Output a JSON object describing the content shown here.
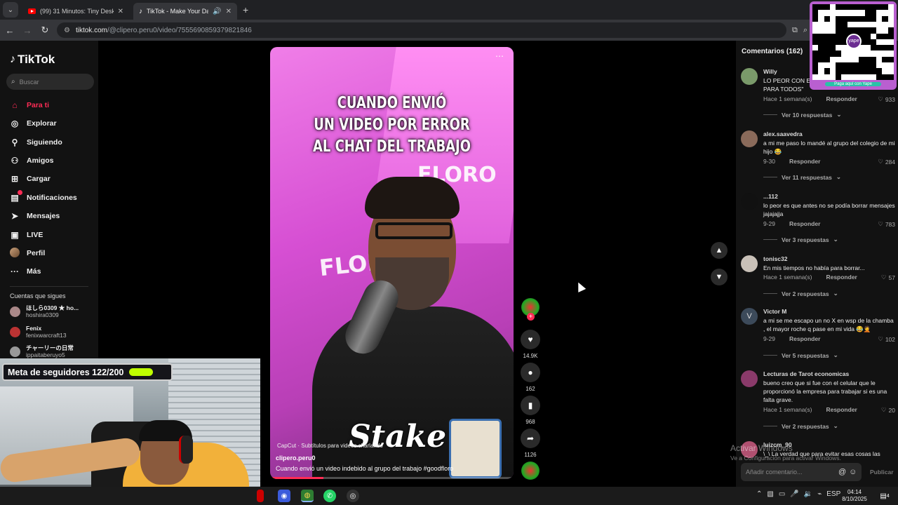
{
  "browser": {
    "tabs": [
      {
        "title": "(99) 31 Minutos: Tiny Desk Con",
        "active": false
      },
      {
        "title": "TikTok - Make Your Day",
        "active": true
      }
    ],
    "url_host": "tiktok.com",
    "url_path": "/@clipero.peru0/video/7555690859379821846"
  },
  "sidebar": {
    "logo": "TikTok",
    "search_placeholder": "Buscar",
    "nav": [
      {
        "label": "Para ti",
        "icon": "home-icon",
        "active": true
      },
      {
        "label": "Explorar",
        "icon": "compass-icon"
      },
      {
        "label": "Siguiendo",
        "icon": "following-icon"
      },
      {
        "label": "Amigos",
        "icon": "friends-icon"
      },
      {
        "label": "Cargar",
        "icon": "upload-icon"
      },
      {
        "label": "Notificaciones",
        "icon": "inbox-icon"
      },
      {
        "label": "Mensajes",
        "icon": "send-icon"
      },
      {
        "label": "LIVE",
        "icon": "live-icon"
      },
      {
        "label": "Perfil",
        "icon": "profile-avatar"
      },
      {
        "label": "Más",
        "icon": "more-icon"
      }
    ],
    "following_title": "Cuentas que sigues",
    "following": [
      {
        "name": "ほしら0309 ★ ho...",
        "handle": "hoshira0309"
      },
      {
        "name": "Fenix",
        "handle": "fenixwarcraft13"
      },
      {
        "name": "チャーリーの日常",
        "handle": "ippaitaberuyo5"
      }
    ]
  },
  "video": {
    "caption_lines": [
      "CUANDO ENVIÓ",
      "UN VIDEO POR ERROR",
      "AL CHAT DEL TRABAJO"
    ],
    "sponsor": "Stake",
    "capcut": "CapCut · Subtítulos para videos charlando",
    "author": "clipero.peru0",
    "description": "Cuando envió un video indebido al grupo del trabajo #goodfloro",
    "progress": 0.22
  },
  "actions": {
    "likes": "14.9K",
    "comments": "162",
    "saves": "968",
    "shares": "1126"
  },
  "comments": {
    "title": "Comentarios (162)",
    "items": [
      {
        "user": "Willy",
        "text": "LO PEOR CON EL ... LA OPCIÓN \"BORRAR PARA TODOS\"",
        "time": "Hace 1 semana(s)",
        "reply": "Responder",
        "likes": "933",
        "more": "Ver 10 respuestas"
      },
      {
        "user": "alex.saavedra",
        "text": "a mi me paso lo mandé al grupo del colegio de mi hijo 😂",
        "time": "9-30",
        "reply": "Responder",
        "likes": "284",
        "more": "Ver 11 respuestas"
      },
      {
        "user": "...112",
        "text": "lo peor es que antes no se podía borrar mensajes jajajajja",
        "time": "9-29",
        "reply": "Responder",
        "likes": "783",
        "more": "Ver 3 respuestas"
      },
      {
        "user": "tonisc32",
        "text": "En mis tiempos no había para borrar...",
        "time": "Hace 1 semana(s)",
        "reply": "Responder",
        "likes": "57",
        "more": "Ver 2 respuestas"
      },
      {
        "user": "Victor M",
        "text": "a mi se me escapo un no X en wsp de la chamba , el mayor roche q pase en mi vida 😂🤦",
        "time": "9-29",
        "reply": "Responder",
        "likes": "102",
        "more": "Ver 5 respuestas"
      },
      {
        "user": "Lecturas de Tarot economicas",
        "text": "bueno creo que si fue con el celular que le proporcionó la empresa para trabajar si es una falta grave.",
        "time": "Hace 1 semana(s)",
        "reply": "Responder",
        "likes": "20",
        "more": "Ver 2 respuestas"
      },
      {
        "user": "luizcm_90",
        "text": "\\_\\ La verdad que para evitar esas cosas las",
        "time": "",
        "reply": "",
        "likes": "",
        "more": ""
      }
    ],
    "input_placeholder": "Añadir comentario...",
    "publish_label": "Publicar"
  },
  "qr": {
    "brand": "yape",
    "label": "Paga aquí con Yape"
  },
  "watermark": {
    "line1": "Activar Windows",
    "line2": "Ve a Configuración para activar Windows."
  },
  "stream_goal": {
    "label": "Meta de seguidores 122/200",
    "progress": 0.61
  },
  "taskbar": {
    "lang": "ESP",
    "time": "04:14",
    "date": "8/10/2025",
    "notif_count": "4"
  }
}
